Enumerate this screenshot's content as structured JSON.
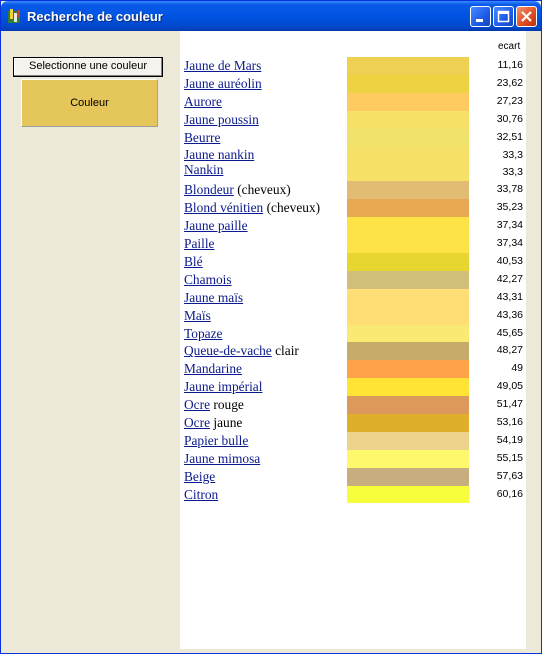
{
  "window": {
    "title": "Recherche de couleur"
  },
  "controls": {
    "select_label": "Selectionne une couleur",
    "color_label": "Couleur",
    "selected_color": "#E5C65A"
  },
  "table": {
    "header": "ecart",
    "rows": [
      {
        "link": "Jaune de Mars",
        "suffix": "",
        "color": "#EED153",
        "ecart": "11,16"
      },
      {
        "link": "Jaune auréolin",
        "suffix": "",
        "color": "#EFD242",
        "ecart": "23,62"
      },
      {
        "link": "Aurore",
        "suffix": "",
        "color": "#FFCB60",
        "ecart": "27,23"
      },
      {
        "link": "Jaune poussin",
        "suffix": "",
        "color": "#F7E269",
        "ecart": "30,76"
      },
      {
        "link": "Beurre",
        "suffix": "",
        "color": "#F0E36B",
        "ecart": "32,51"
      },
      {
        "link": "Jaune nankin",
        "link2": "Nankin",
        "color": "#F7E269",
        "ecart": "33,3",
        "ecart2": "33,3"
      },
      {
        "link": "Blondeur",
        "suffix": " (cheveux)",
        "color": "#E2BC74",
        "ecart": "33,78"
      },
      {
        "link": "Blond vénitien",
        "suffix": " (cheveux)",
        "color": "#E7A854",
        "ecart": "35,23"
      },
      {
        "link": "Jaune paille",
        "suffix": "",
        "color": "#FEE347",
        "ecart": "37,34"
      },
      {
        "link": "Paille",
        "suffix": "",
        "color": "#FEE347",
        "ecart": "37,34"
      },
      {
        "link": "Blé",
        "suffix": "",
        "color": "#E8D630",
        "ecart": "40,53"
      },
      {
        "link": "Chamois",
        "suffix": "",
        "color": "#D0C07A",
        "ecart": "42,27"
      },
      {
        "link": "Jaune maïs",
        "suffix": "",
        "color": "#FFDE75",
        "ecart": "43,31"
      },
      {
        "link": "Maïs",
        "suffix": "",
        "color": "#FFDE75",
        "ecart": "43,36"
      },
      {
        "link": "Topaze",
        "suffix": "",
        "color": "#FAEA73",
        "ecart": "45,65"
      },
      {
        "link": "Queue-de-vache",
        "suffix": " clair",
        "color": "#C6AB6A",
        "ecart": "48,27"
      },
      {
        "link": "Mandarine",
        "suffix": "",
        "color": "#FEA347",
        "ecart": "49"
      },
      {
        "link": "Jaune impérial",
        "suffix": "",
        "color": "#FFE436",
        "ecart": "49,05"
      },
      {
        "link": "Ocre",
        "suffix": " rouge",
        "color": "#DD985C",
        "ecart": "51,47"
      },
      {
        "link": "Ocre",
        "suffix": " jaune",
        "color": "#DFAF2C",
        "ecart": "53,16"
      },
      {
        "link": "Papier bulle",
        "suffix": "",
        "color": "#EDD38C",
        "ecart": "54,19"
      },
      {
        "link": "Jaune mimosa",
        "suffix": "",
        "color": "#FEF86C",
        "ecart": "55,15"
      },
      {
        "link": "Beige",
        "suffix": "",
        "color": "#C8AD7F",
        "ecart": "57,63"
      },
      {
        "link": "Citron",
        "suffix": "",
        "color": "#F7FF3C",
        "ecart": "60,16"
      }
    ]
  }
}
